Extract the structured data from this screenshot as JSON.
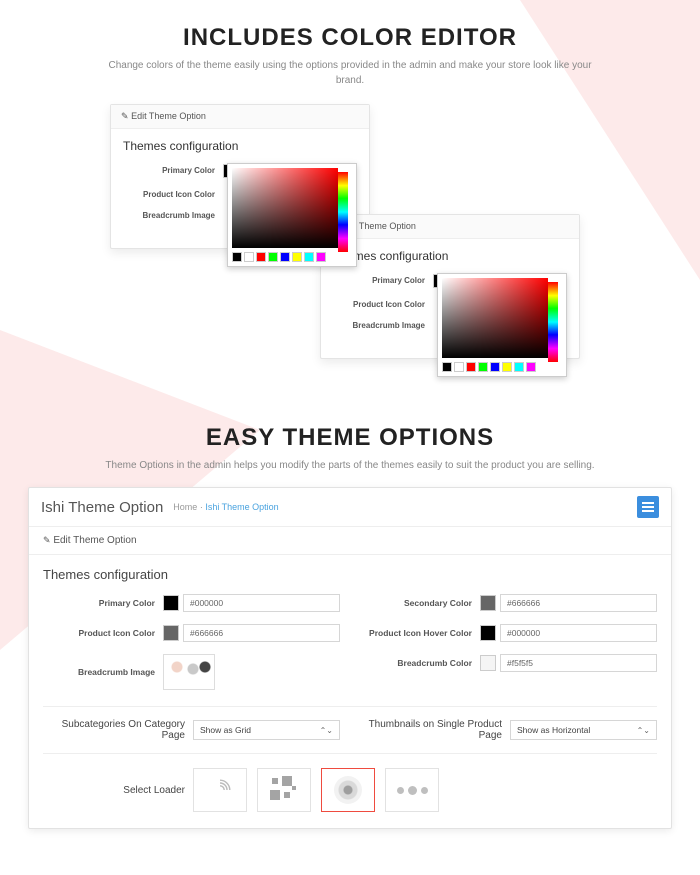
{
  "section1": {
    "title": "INCLUDES COLOR EDITOR",
    "subtitle": "Change colors of the theme easily using the options provided in the admin and make your store look like your brand.",
    "panel": {
      "header": "Edit Theme Option",
      "config_title": "Themes configuration",
      "primary_label": "Primary Color",
      "primary_hex": "#000000",
      "icon_label": "Product Icon Color",
      "crumb_label": "Breadcrumb Image"
    }
  },
  "section2": {
    "title": "EASY THEME OPTIONS",
    "subtitle": "Theme Options in the admin helps you modify the parts of the themes easily to suit the product you are selling.",
    "page_title": "Ishi Theme Option",
    "crumb_home": "Home",
    "crumb_sep": " · ",
    "crumb_current": "Ishi Theme Option",
    "sub_header": "Edit Theme Option",
    "config_title": "Themes configuration",
    "fields": {
      "primary_label": "Primary Color",
      "primary_hex": "#000000",
      "secondary_label": "Secondary Color",
      "secondary_hex": "#666666",
      "icon_label": "Product Icon Color",
      "icon_hex": "#666666",
      "hover_label": "Product Icon Hover Color",
      "hover_hex": "#000000",
      "crumb_img_label": "Breadcrumb Image",
      "crumb_color_label": "Breadcrumb Color",
      "crumb_color_hex": "#f5f5f5",
      "subcat_label": "Subcategories On Category Page",
      "subcat_value": "Show as Grid",
      "thumb_label": "Thumbnails on Single Product Page",
      "thumb_value": "Show as Horizontal",
      "loader_label": "Select Loader"
    }
  },
  "colors": {
    "black": "#000000",
    "grey": "#666666",
    "light": "#f5f5f5"
  }
}
